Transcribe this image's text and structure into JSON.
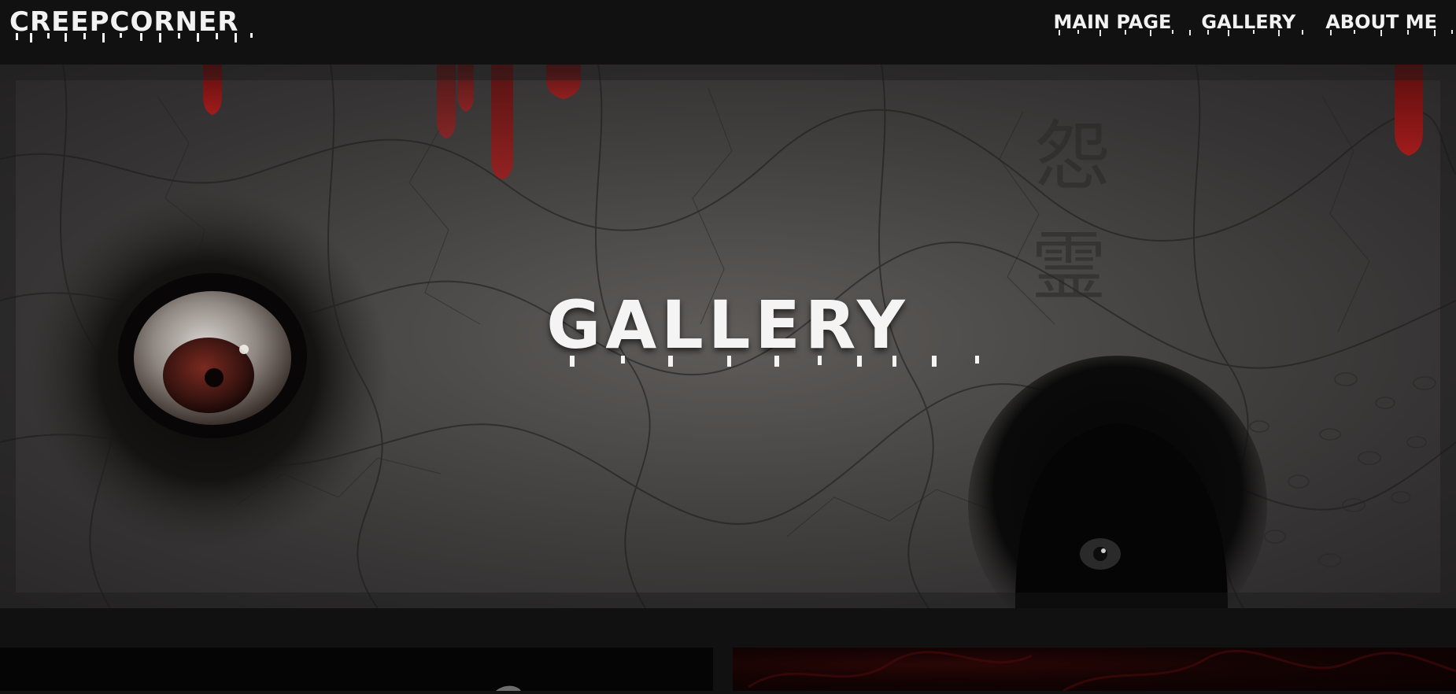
{
  "header": {
    "brand": "CREEPCORNER",
    "nav": [
      {
        "label": "MAIN PAGE"
      },
      {
        "label": "GALLERY"
      },
      {
        "label": "ABOUT ME"
      }
    ]
  },
  "hero": {
    "title": "GALLERY",
    "kanji_top": "怨",
    "kanji_bottom": "霊"
  },
  "colors": {
    "background": "#111111",
    "text": "#f2f2f2",
    "blood": "#8a1616"
  }
}
